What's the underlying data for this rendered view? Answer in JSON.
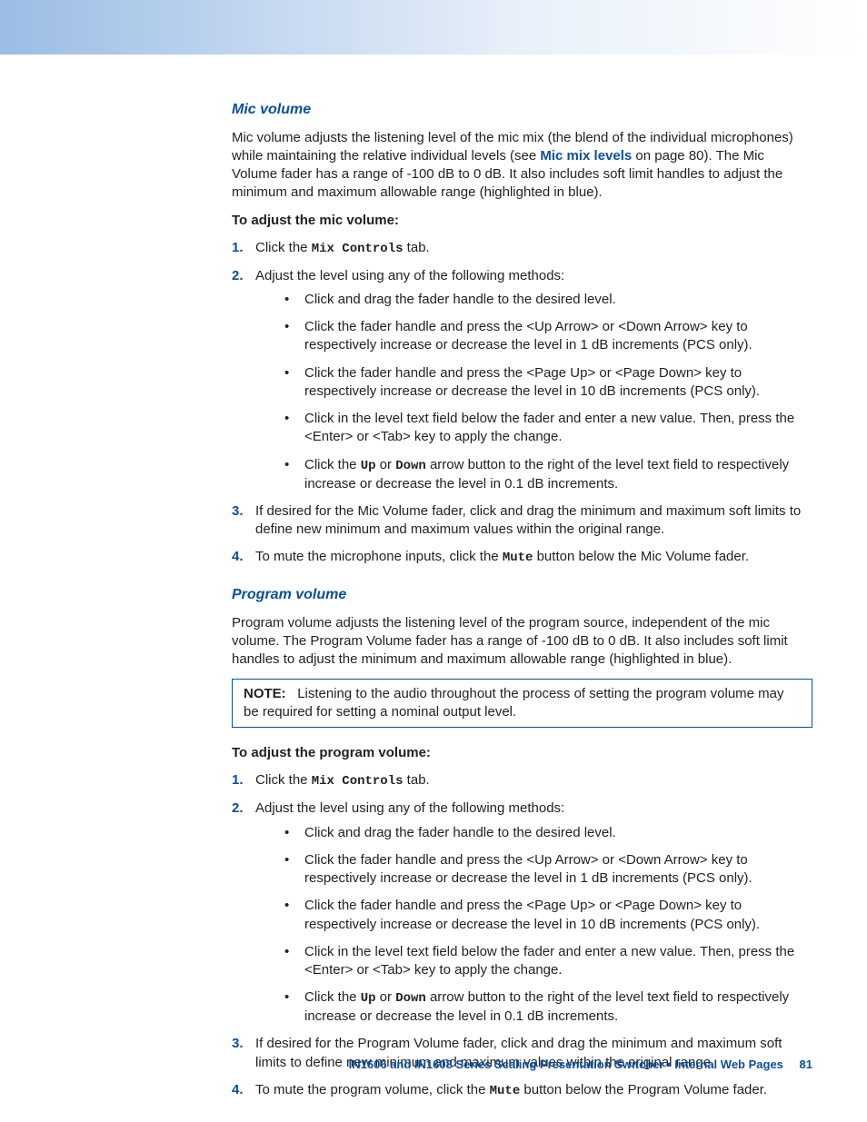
{
  "sections": {
    "mic": {
      "heading": "Mic volume",
      "intro_a": "Mic volume adjusts the listening level of the mic mix (the blend of the individual microphones) while maintaining the relative individual levels (see ",
      "intro_link": "Mic mix levels",
      "intro_b": " on page 80). The Mic Volume fader has a range of -100 dB to 0 dB. It also includes soft limit handles to adjust the minimum and maximum allowable range (highlighted in blue).",
      "adjust_heading": "To adjust the mic volume:",
      "steps": {
        "s1_a": "Click the ",
        "s1_code": "Mix Controls",
        "s1_b": " tab.",
        "s2": "Adjust the level using any of the following methods:",
        "bullets": {
          "b1": "Click and drag the fader handle to the desired level.",
          "b2": "Click the fader handle and press the <Up Arrow> or <Down Arrow> key to respectively increase or decrease the level in 1 dB increments (PCS only).",
          "b3": "Click the fader handle and press the <Page Up> or <Page Down> key to respectively increase or decrease the level in 10 dB increments (PCS only).",
          "b4": "Click in the level text field below the fader and enter a new value. Then, press the <Enter> or <Tab> key to apply the change.",
          "b5_a": "Click the ",
          "b5_up": "Up",
          "b5_mid": " or ",
          "b5_down": "Down",
          "b5_b": " arrow button to the right of the level text field to respectively increase or decrease the level in 0.1 dB increments."
        },
        "s3": "If desired for the Mic Volume fader, click and drag the minimum and maximum soft limits to define new minimum and maximum values within the original range.",
        "s4_a": "To mute the microphone inputs, click the ",
        "s4_code": "Mute",
        "s4_b": " button below the Mic Volume fader."
      }
    },
    "prog": {
      "heading": "Program volume",
      "intro": "Program volume adjusts the listening level of the program source, independent of the mic volume. The Program Volume fader has a range of -100 dB to 0 dB. It also includes soft limit handles to adjust the minimum and maximum allowable range (highlighted in blue).",
      "note_label": "NOTE:",
      "note_text": "Listening to the audio throughout the process of setting the program volume may be required for setting a nominal output level.",
      "adjust_heading": "To adjust the program volume:",
      "steps": {
        "s1_a": "Click the ",
        "s1_code": "Mix Controls",
        "s1_b": " tab.",
        "s2": "Adjust the level using any of the following methods:",
        "bullets": {
          "b1": "Click and drag the fader handle to the desired level.",
          "b2": "Click the fader handle and press the <Up Arrow> or <Down Arrow> key to respectively increase or decrease the level in 1 dB increments (PCS only).",
          "b3": "Click the fader handle and press the <Page Up> or <Page Down> key to respectively increase or decrease the level in 10 dB increments (PCS only).",
          "b4": "Click in the level text field below the fader and enter a new value. Then, press the <Enter> or <Tab> key to apply the change.",
          "b5_a": "Click the ",
          "b5_up": "Up",
          "b5_mid": " or ",
          "b5_down": "Down",
          "b5_b": " arrow button to the right of the level text field to respectively increase or decrease the level in 0.1 dB increments."
        },
        "s3": "If desired for the Program Volume fader, click and drag the minimum and maximum soft limits to define new minimum and maximum values within the original range.",
        "s4_a": "To mute the program volume, click the ",
        "s4_code": "Mute",
        "s4_b": " button below the Program Volume fader."
      }
    }
  },
  "footer": {
    "text": "IN1606 and IN1608 Series Scaling Presentation Switcher • Internal Web Pages",
    "page": "81"
  },
  "nums": {
    "n1": "1.",
    "n2": "2.",
    "n3": "3.",
    "n4": "4."
  }
}
